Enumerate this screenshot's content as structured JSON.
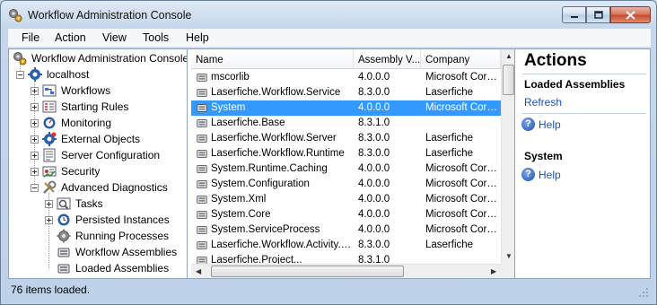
{
  "window": {
    "title": "Workflow Administration Console"
  },
  "menu": [
    "File",
    "Action",
    "View",
    "Tools",
    "Help"
  ],
  "tree": {
    "root": "Workflow Administration Console",
    "server": "localhost",
    "items": [
      {
        "label": "Workflows",
        "icon": "workflows-icon"
      },
      {
        "label": "Starting Rules",
        "icon": "starting-rules-icon"
      },
      {
        "label": "Monitoring",
        "icon": "monitoring-icon"
      },
      {
        "label": "External Objects",
        "icon": "external-objects-icon"
      },
      {
        "label": "Server Configuration",
        "icon": "server-configuration-icon"
      },
      {
        "label": "Security",
        "icon": "security-icon"
      },
      {
        "label": "Advanced Diagnostics",
        "icon": "advanced-diagnostics-icon"
      }
    ],
    "diagnostics": [
      {
        "label": "Tasks",
        "icon": "tasks-icon"
      },
      {
        "label": "Persisted Instances",
        "icon": "persisted-instances-icon"
      },
      {
        "label": "Running Processes",
        "icon": "running-processes-icon"
      },
      {
        "label": "Workflow Assemblies",
        "icon": "assembly-icon"
      },
      {
        "label": "Loaded Assemblies",
        "icon": "assembly-icon"
      }
    ]
  },
  "list": {
    "columns": [
      "Name",
      "Assembly V...",
      "Company"
    ],
    "rows": [
      {
        "name": "mscorlib",
        "version": "4.0.0.0",
        "company": "Microsoft Corpor..."
      },
      {
        "name": "Laserfiche.Workflow.Service",
        "version": "8.3.0.0",
        "company": "Laserfiche"
      },
      {
        "name": "System",
        "version": "4.0.0.0",
        "company": "Microsoft Corpor..."
      },
      {
        "name": "Laserfiche.Base",
        "version": "8.3.1.0",
        "company": ""
      },
      {
        "name": "Laserfiche.Workflow.Server",
        "version": "8.3.0.0",
        "company": "Laserfiche"
      },
      {
        "name": "Laserfiche.Workflow.Runtime",
        "version": "8.3.0.0",
        "company": "Laserfiche"
      },
      {
        "name": "System.Runtime.Caching",
        "version": "4.0.0.0",
        "company": "Microsoft Corpor..."
      },
      {
        "name": "System.Configuration",
        "version": "4.0.0.0",
        "company": "Microsoft Corpor..."
      },
      {
        "name": "System.Xml",
        "version": "4.0.0.0",
        "company": "Microsoft Corpor..."
      },
      {
        "name": "System.Core",
        "version": "4.0.0.0",
        "company": "Microsoft Corpor..."
      },
      {
        "name": "System.ServiceProcess",
        "version": "4.0.0.0",
        "company": "Microsoft Corpor..."
      },
      {
        "name": "Laserfiche.Workflow.Activity.B...",
        "version": "8.3.0.0",
        "company": "Laserfiche"
      },
      {
        "name": "Laserfiche.Project...",
        "version": "8.3.1.0",
        "company": ""
      }
    ],
    "selected_index": 2
  },
  "actions": {
    "title": "Actions",
    "section1": "Loaded Assemblies",
    "refresh": "Refresh",
    "help1": "Help",
    "section2": "System",
    "help2": "Help"
  },
  "status": "76 items loaded.",
  "colors": {
    "selection": "#3399ff",
    "link": "#1a52b4"
  }
}
